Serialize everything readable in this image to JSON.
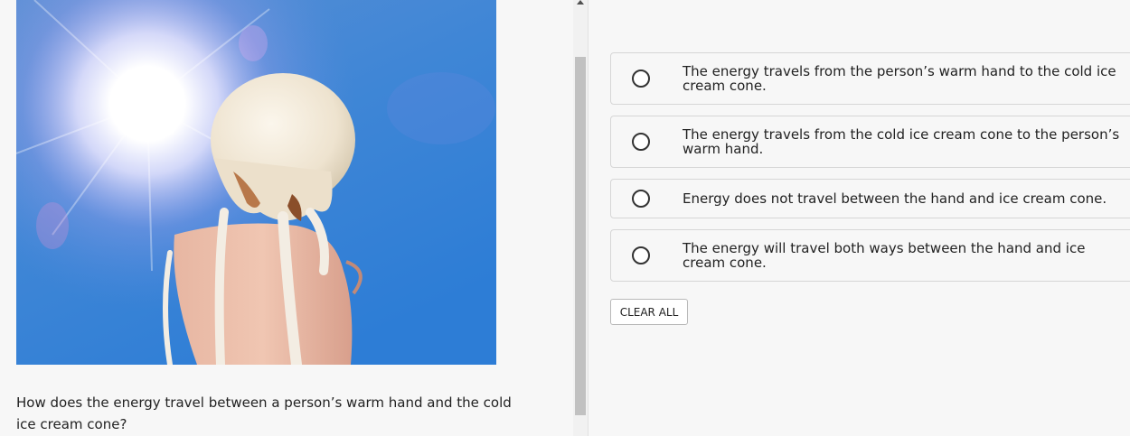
{
  "question": {
    "image_alt": "hand holding melting ice cream cone in the sun",
    "text": "How does the energy travel between a person’s warm hand and the cold ice cream cone?"
  },
  "choices": [
    {
      "label": "The energy travels from the person’s warm hand to the cold ice cream cone.",
      "selected": false
    },
    {
      "label": "The energy travels from the cold ice cream cone to the person’s warm hand.",
      "selected": false
    },
    {
      "label": "Energy does not travel between the hand and ice cream cone.",
      "selected": false
    },
    {
      "label": "The energy will travel both ways between the hand and ice cream cone.",
      "selected": false
    }
  ],
  "actions": {
    "clear_all_label": "CLEAR ALL"
  },
  "colors": {
    "sky": "#4d8cd6",
    "border": "#d6d6d6",
    "background": "#f7f7f7"
  }
}
